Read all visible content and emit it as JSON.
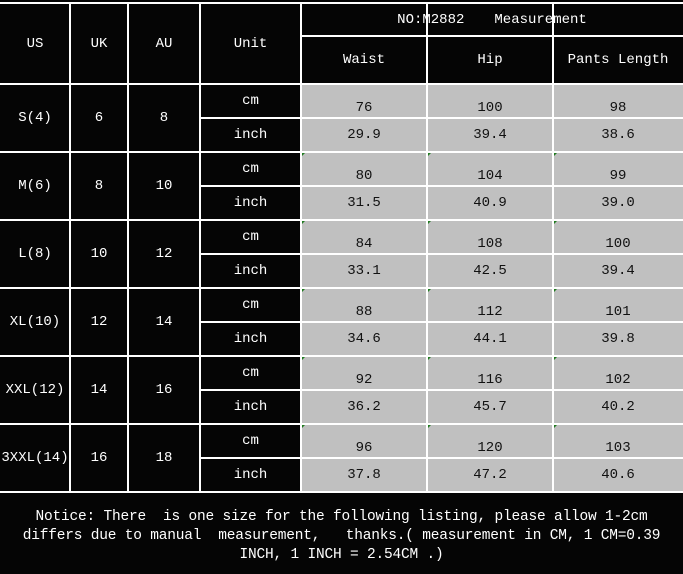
{
  "header": {
    "us": "US",
    "uk": "UK",
    "au": "AU",
    "unit": "Unit",
    "title_no": "NO:M2882",
    "title_label": "Measurement",
    "columns": [
      "Waist",
      "Hip",
      "Pants Length"
    ]
  },
  "units": {
    "cm": "cm",
    "inch": "inch"
  },
  "rows": [
    {
      "us": "S(4)",
      "uk": "6",
      "au": "8",
      "cm": [
        "76",
        "100",
        "98"
      ],
      "inch": [
        "29.9",
        "39.4",
        "38.6"
      ]
    },
    {
      "us": "M(6)",
      "uk": "8",
      "au": "10",
      "cm": [
        "80",
        "104",
        "99"
      ],
      "inch": [
        "31.5",
        "40.9",
        "39.0"
      ]
    },
    {
      "us": "L(8)",
      "uk": "10",
      "au": "12",
      "cm": [
        "84",
        "108",
        "100"
      ],
      "inch": [
        "33.1",
        "42.5",
        "39.4"
      ]
    },
    {
      "us": "XL(10)",
      "uk": "12",
      "au": "14",
      "cm": [
        "88",
        "112",
        "101"
      ],
      "inch": [
        "34.6",
        "44.1",
        "39.8"
      ]
    },
    {
      "us": "XXL(12)",
      "uk": "14",
      "au": "16",
      "cm": [
        "92",
        "116",
        "102"
      ],
      "inch": [
        "36.2",
        "45.7",
        "40.2"
      ]
    },
    {
      "us": "3XXL(14)",
      "uk": "16",
      "au": "18",
      "cm": [
        "96",
        "120",
        "103"
      ],
      "inch": [
        "37.8",
        "47.2",
        "40.6"
      ]
    }
  ],
  "notice": {
    "line1": "Notice: There  is one size for the following listing, please allow 1-2cm",
    "line2": "differs due to manual  measurement,   thanks.( measurement in CM, 1 CM=0.39",
    "line3": "INCH, 1 INCH = 2.54CM .)"
  },
  "colors": {
    "background": "#050505",
    "value_cell": "#c0c0c0",
    "grid": "#ffffff",
    "marker": "#1f7a1f"
  }
}
